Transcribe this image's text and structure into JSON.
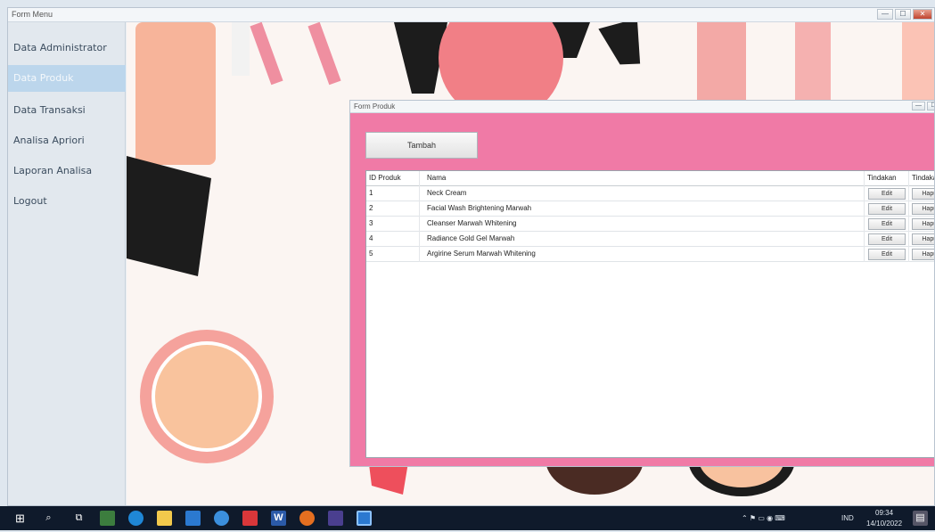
{
  "window": {
    "title": "Form Menu",
    "controls": [
      "—",
      "☐",
      "✕"
    ]
  },
  "sidebar": {
    "items": [
      {
        "label": "Data Administrator"
      },
      {
        "label": "Data Produk"
      },
      {
        "label": "Data Transaksi"
      },
      {
        "label": "Analisa Apriori"
      },
      {
        "label": "Laporan Analisa"
      },
      {
        "label": "Logout"
      }
    ]
  },
  "product_form": {
    "title": "Form Produk",
    "add_label": "Tambah",
    "columns": [
      "ID Produk",
      "Nama",
      "Tindakan",
      "Tindakan"
    ],
    "edit_label": "Edit",
    "delete_label": "Hapus",
    "rows": [
      {
        "id": "1",
        "name": "Neck Cream"
      },
      {
        "id": "2",
        "name": "Facial Wash Brightening Marwah"
      },
      {
        "id": "3",
        "name": "Cleanser Marwah Whitening"
      },
      {
        "id": "4",
        "name": "Radiance Gold Gel Marwah"
      },
      {
        "id": "5",
        "name": "Argirine Serum Marwah Whitening"
      }
    ]
  },
  "taskbar": {
    "language": "IND",
    "time": "09:34",
    "date": "14/10/2022"
  },
  "colors": {
    "form_bg": "#f07aa6",
    "sidebar_active": "#bcd6ec",
    "taskbar": "#0f1a2b"
  }
}
